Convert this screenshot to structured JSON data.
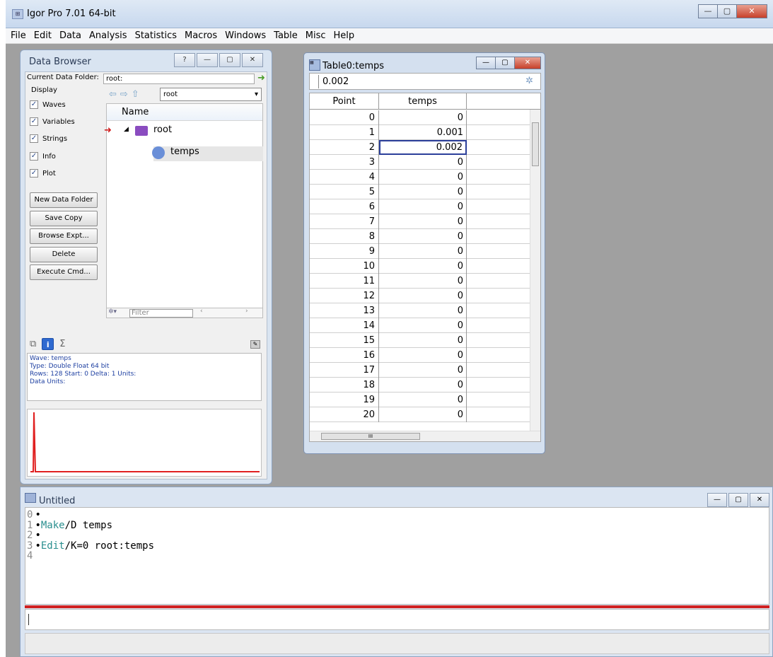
{
  "app": {
    "title": "Igor Pro 7.01 64-bit"
  },
  "menu": [
    "File",
    "Edit",
    "Data",
    "Analysis",
    "Statistics",
    "Macros",
    "Windows",
    "Table",
    "Misc",
    "Help"
  ],
  "data_browser": {
    "title": "Data Browser",
    "current_folder_label": "Current Data Folder:",
    "current_folder_value": "root:",
    "display_label": "Display",
    "checkboxes": [
      "Waves",
      "Variables",
      "Strings",
      "Info",
      "Plot"
    ],
    "folder_select": "root",
    "tree_header": "Name",
    "tree_root": "root",
    "tree_wave": "temps",
    "buttons": [
      "New Data Folder",
      "Save Copy",
      "Browse Expt...",
      "Delete",
      "Execute Cmd..."
    ],
    "filter_placeholder": "Filter",
    "sigma": "Σ",
    "info": {
      "wave": "Wave: temps",
      "type": "Type: Double Float 64 bit",
      "rows": "Rows: 128  Start: 0  Delta: 1  Units:",
      "data_units": "Data Units:"
    },
    "plot_color": "#e02020"
  },
  "table": {
    "title": "Table0:temps",
    "entry_value": "0.002",
    "col_point": "Point",
    "col_temps": "temps",
    "points": [
      "0",
      "1",
      "2",
      "3",
      "4",
      "5",
      "6",
      "7",
      "8",
      "9",
      "10",
      "11",
      "12",
      "13",
      "14",
      "15",
      "16",
      "17",
      "18",
      "19",
      "20"
    ],
    "values": [
      "0",
      "0.001",
      "0.002",
      "0",
      "0",
      "0",
      "0",
      "0",
      "0",
      "0",
      "0",
      "0",
      "0",
      "0",
      "0",
      "0",
      "0",
      "0",
      "0",
      "0",
      "0"
    ],
    "selected_row": 2
  },
  "command_window": {
    "title": "Untitled",
    "history": [
      {
        "num": "0",
        "bullet": "•",
        "kw": "",
        "rest": ""
      },
      {
        "num": "1",
        "bullet": "•",
        "kw": "Make",
        "rest": "/D temps"
      },
      {
        "num": "2",
        "bullet": "•",
        "kw": "",
        "rest": ""
      },
      {
        "num": "3",
        "bullet": "•",
        "kw": "Edit",
        "rest": "/K=0 root:temps"
      },
      {
        "num": "4",
        "bullet": "",
        "kw": "",
        "rest": ""
      }
    ]
  }
}
